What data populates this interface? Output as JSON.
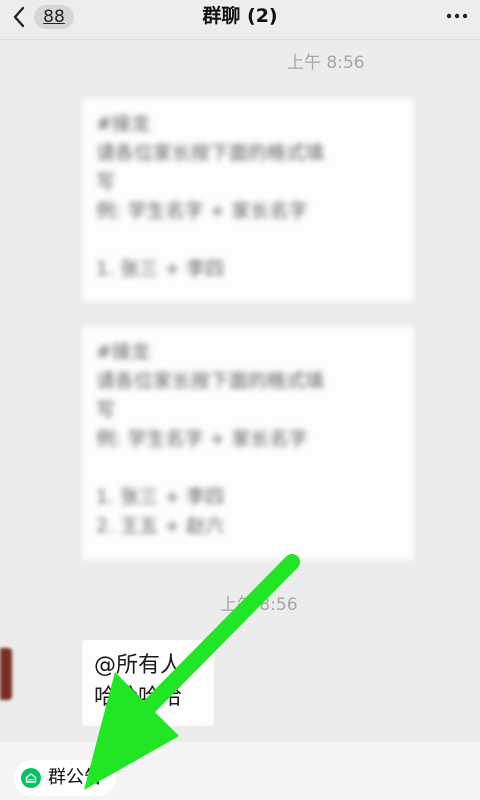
{
  "navbar": {
    "back_badge": "88",
    "title": "群聊 (2)"
  },
  "chat": {
    "timestamp_1": "上午 8:56",
    "timestamp_2": "上午 8:56",
    "messages": [
      {
        "lines": [
          "#接龙",
          "请各位家长按下面的格式填",
          "写",
          "例: 学生名字 + 家长名字",
          "",
          "1. 张三 + 李四"
        ]
      },
      {
        "lines": [
          "#接龙",
          "请各位家长按下面的格式填",
          "写",
          "例: 学生名字 + 家长名字",
          "",
          "1. 张三 + 李四",
          "2. 王五 + 赵六"
        ]
      },
      {
        "lines": [
          "@所有人",
          "哈哈哈哈"
        ]
      }
    ]
  },
  "bottom": {
    "notice_label": "群公告"
  },
  "colors": {
    "accent_green": "#07c160",
    "annotation_arrow": "#22e526"
  }
}
